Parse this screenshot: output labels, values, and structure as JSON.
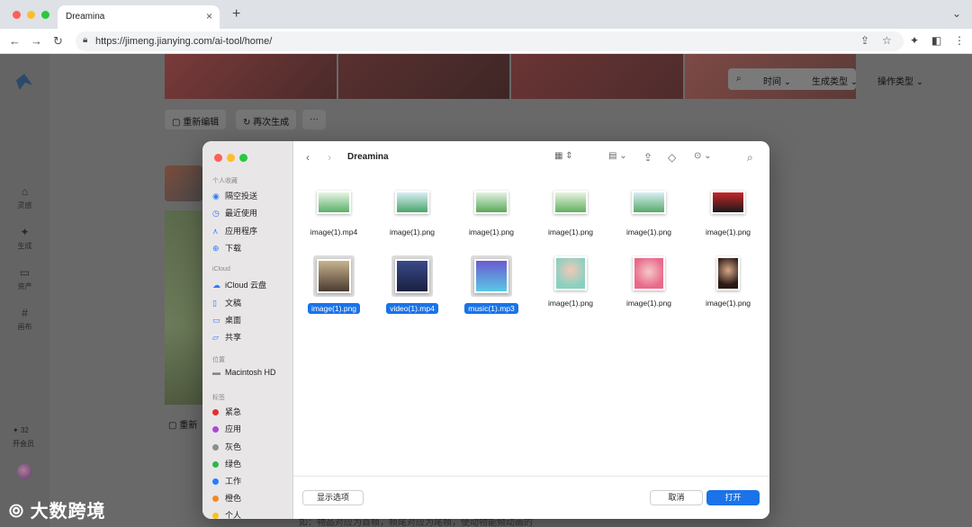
{
  "browser": {
    "tab_title": "Dreamina",
    "url": "https://jimeng.jianying.com/ai-tool/home/"
  },
  "app": {
    "nav": [
      {
        "label": "灵感",
        "icon": "home-icon"
      },
      {
        "label": "生成",
        "icon": "sparkle-icon"
      },
      {
        "label": "资产",
        "icon": "folder-icon"
      },
      {
        "label": "画布",
        "icon": "canvas-icon"
      }
    ],
    "vip_count": "✦ 32",
    "vip_label": "开会员",
    "filters": {
      "time": "时间",
      "gen_type": "生成类型",
      "op_type": "操作类型"
    },
    "actions": {
      "re_edit": "重新编辑",
      "regen": "再次生成",
      "more": "···"
    },
    "re_edit_short": "重新",
    "footer_text": "如：物品对应为首帧，帧尾对应为尾帧，使动物能频动画的"
  },
  "dialog": {
    "folder": "Dreamina",
    "sidebar": {
      "favorites_heading": "个人收藏",
      "favorites": [
        {
          "label": "隔空投送",
          "icon": "airdrop-icon"
        },
        {
          "label": "最近使用",
          "icon": "clock-icon"
        },
        {
          "label": "应用程序",
          "icon": "apps-icon"
        },
        {
          "label": "下载",
          "icon": "download-icon"
        }
      ],
      "icloud_heading": "iCloud",
      "icloud": [
        {
          "label": "iCloud 云盘",
          "icon": "cloud-icon"
        },
        {
          "label": "文稿",
          "icon": "document-icon"
        },
        {
          "label": "桌面",
          "icon": "desktop-icon"
        },
        {
          "label": "共享",
          "icon": "shared-folder-icon"
        }
      ],
      "locations_heading": "位置",
      "locations": [
        {
          "label": "Macintosh HD",
          "icon": "disk-icon"
        }
      ],
      "tags_heading": "标签",
      "tags": [
        {
          "label": "紧急",
          "color": "#e0312b"
        },
        {
          "label": "应用",
          "color": "#a94bd0"
        },
        {
          "label": "灰色",
          "color": "#8e8e8e"
        },
        {
          "label": "绿色",
          "color": "#2eb84b"
        },
        {
          "label": "工作",
          "color": "#2d7cf6"
        },
        {
          "label": "橙色",
          "color": "#f08a24"
        },
        {
          "label": "个人",
          "color": "#f5c518"
        }
      ]
    },
    "files": [
      {
        "name": "image(1).mp4",
        "selected": false
      },
      {
        "name": "image(1).png",
        "selected": false
      },
      {
        "name": "image(1).png",
        "selected": false
      },
      {
        "name": "image(1).png",
        "selected": false
      },
      {
        "name": "image(1).png",
        "selected": false
      },
      {
        "name": "image(1).png",
        "selected": false
      },
      {
        "name": "image(1).png",
        "selected": true
      },
      {
        "name": "video(1).mp4",
        "selected": true
      },
      {
        "name": "music(1).mp3",
        "selected": true
      },
      {
        "name": "image(1).png",
        "selected": false
      },
      {
        "name": "image(1).png",
        "selected": false
      },
      {
        "name": "image(1).png",
        "selected": false
      }
    ],
    "buttons": {
      "options": "显示选项",
      "cancel": "取消",
      "open": "打开"
    }
  },
  "watermark": "大数跨境",
  "colors": {
    "accent": "#1a73e8",
    "sidebar_bg": "#e9e6e8"
  }
}
